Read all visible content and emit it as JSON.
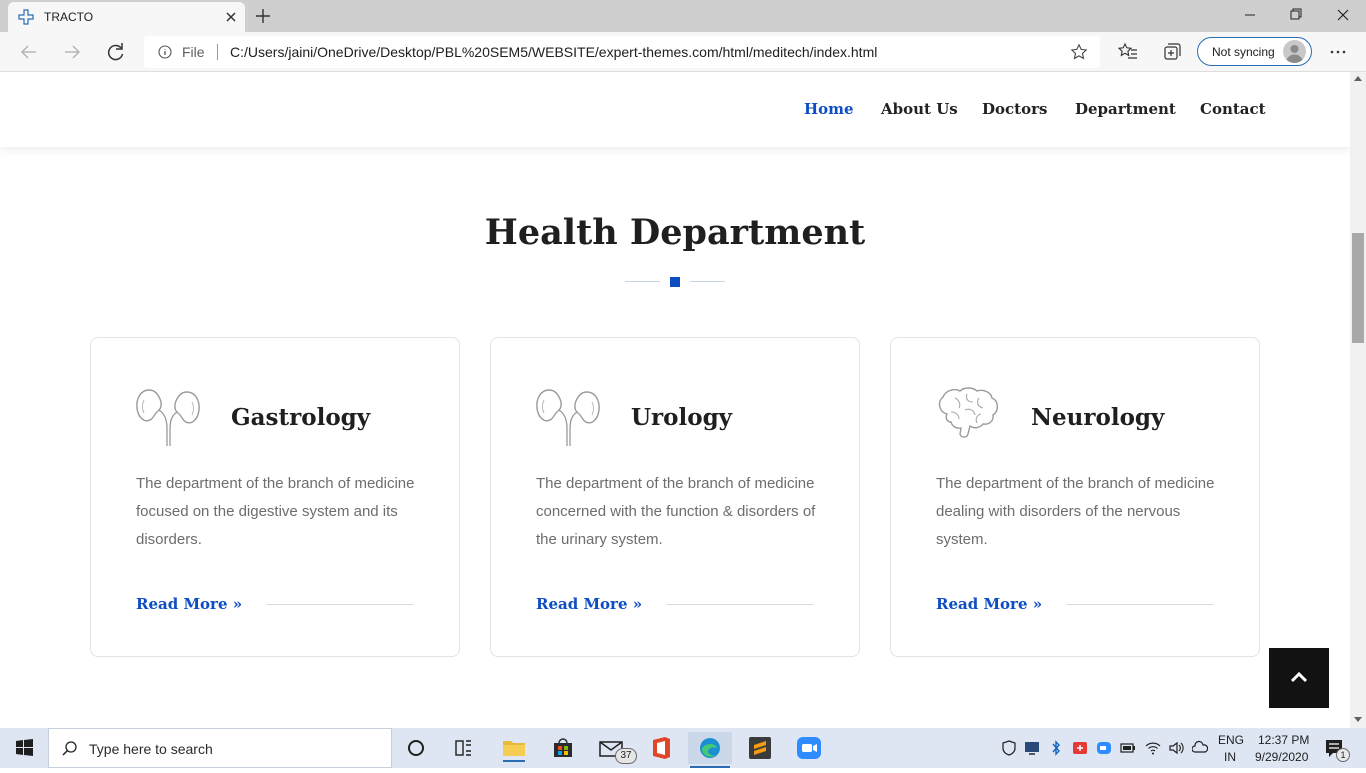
{
  "browser": {
    "tab_title": "TRACTO",
    "address_prefix": "File",
    "url": "C:/Users/jaini/OneDrive/Desktop/PBL%20SEM5/WEBSITE/expert-themes.com/html/meditech/index.html",
    "sync_label": "Not syncing"
  },
  "nav": {
    "items": [
      "Home",
      "About Us",
      "Doctors",
      "Department",
      "Contact"
    ],
    "active": "Home"
  },
  "section": {
    "title": "Health Department"
  },
  "cards": [
    {
      "title": "Gastrology",
      "icon": "kidneys-icon",
      "description": "The department of the branch of medicine focused on the digestive system and its disorders.",
      "link": "Read More"
    },
    {
      "title": "Urology",
      "icon": "kidneys-icon",
      "description": "The department of the branch of medicine concerned with the function & disorders of the urinary system.",
      "link": "Read More"
    },
    {
      "title": "Neurology",
      "icon": "brain-icon",
      "description": "The department of the branch of medicine dealing with disorders of the nervous system.",
      "link": "Read More"
    }
  ],
  "taskbar": {
    "search_placeholder": "Type here to search",
    "mail_badge": "37",
    "language_line1": "ENG",
    "language_line2": "IN",
    "time": "12:37 PM",
    "date": "9/29/2020",
    "notification_count": "1"
  },
  "colors": {
    "accent": "#0c4dc4",
    "heading": "#1f1f1f",
    "body_text": "#6d6d6d"
  }
}
